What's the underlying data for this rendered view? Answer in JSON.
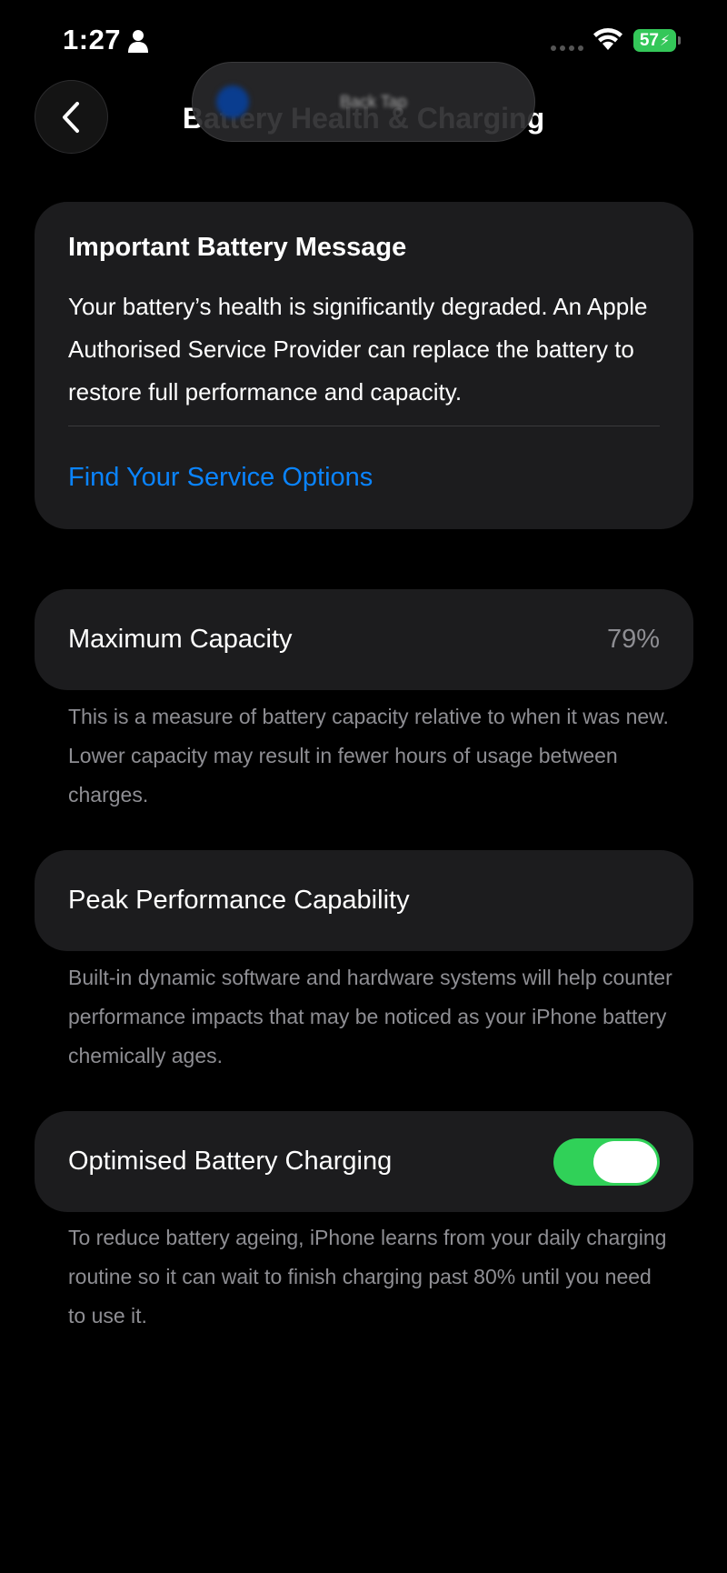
{
  "status_bar": {
    "time": "1:27",
    "battery_level": "57",
    "battery_icon": "bolt"
  },
  "nav": {
    "title": "Battery Health & Charging",
    "back_icon": "chevron-left-icon"
  },
  "notification": {
    "text": "Back Tap"
  },
  "important_message": {
    "title": "Important Battery Message",
    "body": "Your battery’s health is significantly degraded. An Apple Authorised Service Provider can replace the battery to restore full performance and capacity.",
    "link": "Find Your Service Options"
  },
  "maximum_capacity": {
    "label": "Maximum Capacity",
    "value": "79%",
    "footnote": "This is a measure of battery capacity relative to when it was new. Lower capacity may result in fewer hours of usage between charges."
  },
  "peak_performance": {
    "label": "Peak Performance Capability",
    "footnote": "Built-in dynamic software and hardware systems will help counter performance impacts that may be noticed as your iPhone battery chemically ages."
  },
  "optimised_charging": {
    "label": "Optimised Battery Charging",
    "enabled": true,
    "footnote": "To reduce battery ageing, iPhone learns from your daily charging routine so it can wait to finish charging past 80% until you need to use it."
  },
  "colors": {
    "accent": "#0a84ff",
    "toggle_on": "#30d158",
    "battery_fill": "#34c759",
    "card": "#1c1c1e"
  }
}
